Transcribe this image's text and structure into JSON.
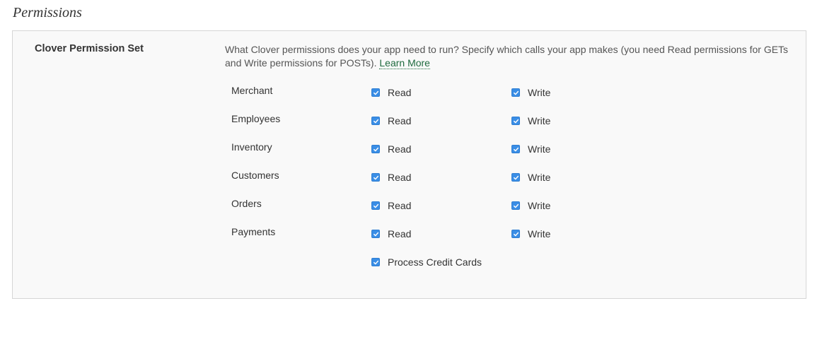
{
  "section": {
    "title": "Permissions"
  },
  "permission_set": {
    "label": "Clover Permission Set",
    "description": "What Clover permissions does your app need to run? Specify which calls your app makes (you need Read permissions for GETs and Write permissions for POSTs).",
    "learn_more": "Learn More"
  },
  "colors": {
    "checkbox_accent": "#3a8ee6",
    "link": "#1e6b3e",
    "panel_bg": "#f9f9f9",
    "panel_border": "#d6d6d6"
  },
  "rows": [
    {
      "resource": "Merchant",
      "read_label": "Read",
      "read_checked": true,
      "write_label": "Write",
      "write_checked": true
    },
    {
      "resource": "Employees",
      "read_label": "Read",
      "read_checked": true,
      "write_label": "Write",
      "write_checked": true
    },
    {
      "resource": "Inventory",
      "read_label": "Read",
      "read_checked": true,
      "write_label": "Write",
      "write_checked": true
    },
    {
      "resource": "Customers",
      "read_label": "Read",
      "read_checked": true,
      "write_label": "Write",
      "write_checked": true
    },
    {
      "resource": "Orders",
      "read_label": "Read",
      "read_checked": true,
      "write_label": "Write",
      "write_checked": true
    },
    {
      "resource": "Payments",
      "read_label": "Read",
      "read_checked": true,
      "write_label": "Write",
      "write_checked": true
    }
  ],
  "extra": {
    "process_credit_cards_label": "Process Credit Cards",
    "process_credit_cards_checked": true
  }
}
